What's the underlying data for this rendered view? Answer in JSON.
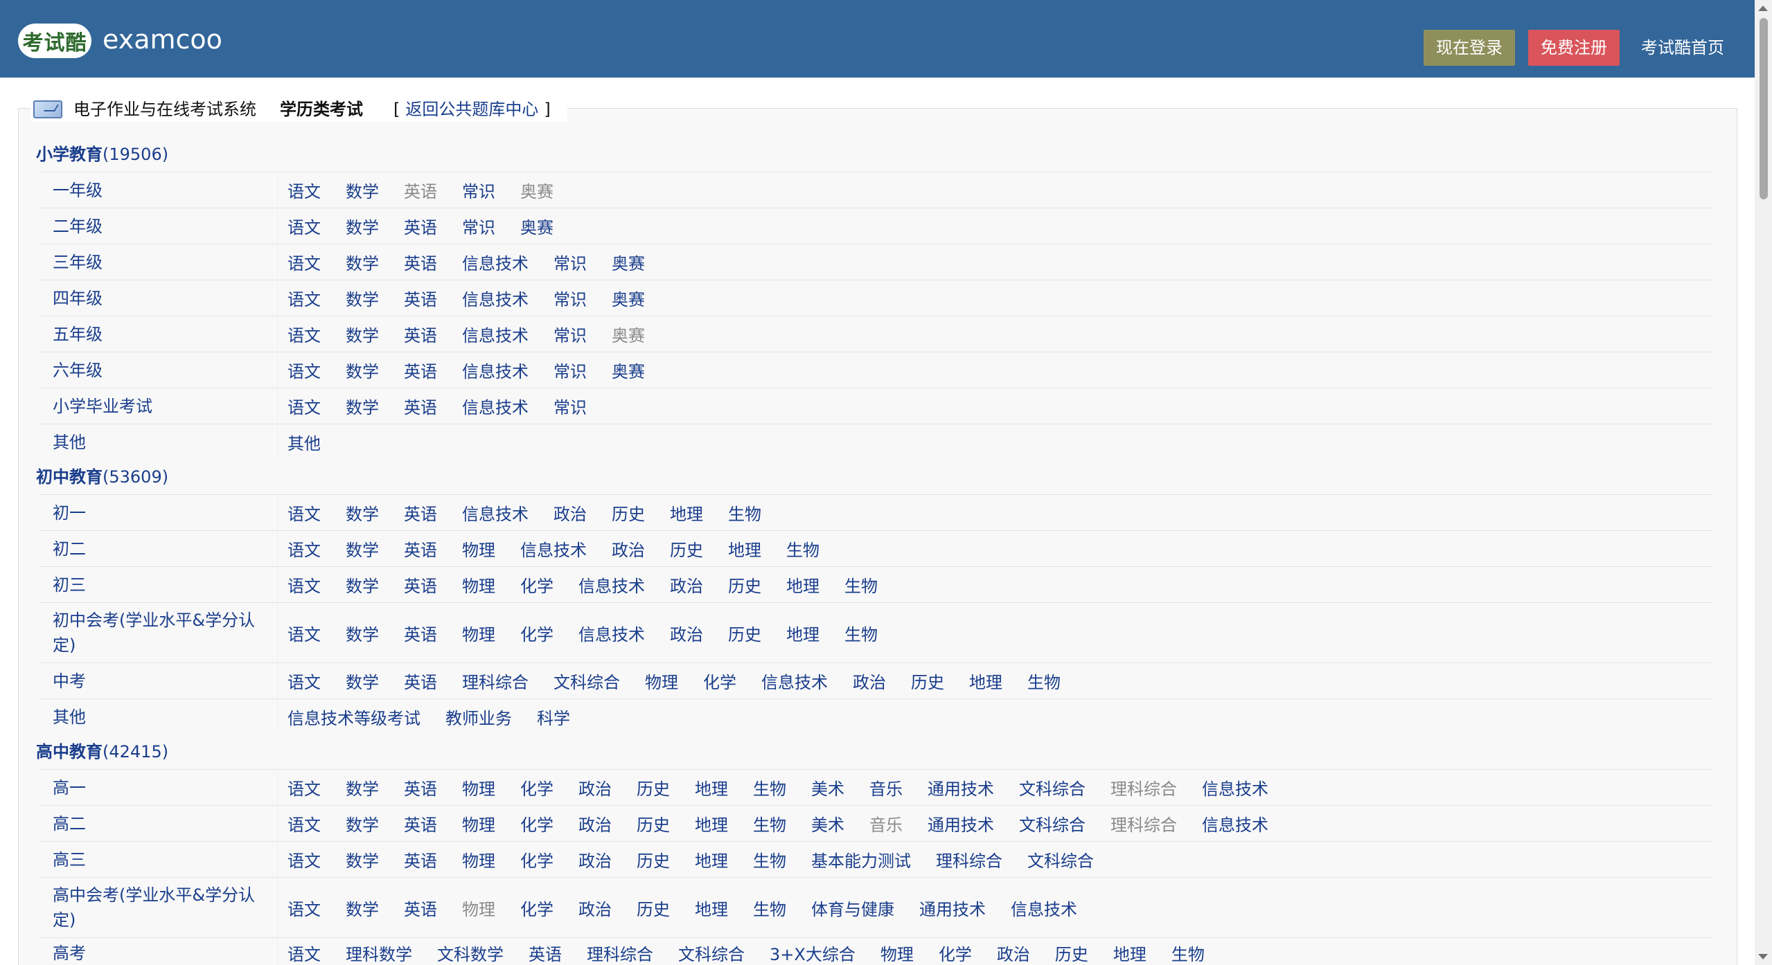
{
  "header": {
    "logo_badge_text": "考试酷",
    "logo_text": "examcoo",
    "login_label": "现在登录",
    "register_label": "免费注册",
    "home_label": "考试酷首页",
    "colors": {
      "bar": "#336699",
      "login": "#8f8f5c",
      "register": "#d9555b"
    }
  },
  "legend": {
    "system_label": "电子作业与在线考试系统",
    "active_label": "学历类考试",
    "bracket_open": "[",
    "back_link": "返回公共题库中心",
    "bracket_close": "]"
  },
  "categories": [
    {
      "name": "小学教育",
      "count": "(19506)",
      "rows": [
        {
          "label": "一年级",
          "subjects": [
            {
              "t": "语文"
            },
            {
              "t": "数学"
            },
            {
              "t": "英语",
              "muted": true
            },
            {
              "t": "常识"
            },
            {
              "t": "奥赛",
              "muted": true
            }
          ]
        },
        {
          "label": "二年级",
          "subjects": [
            {
              "t": "语文"
            },
            {
              "t": "数学"
            },
            {
              "t": "英语"
            },
            {
              "t": "常识"
            },
            {
              "t": "奥赛"
            }
          ]
        },
        {
          "label": "三年级",
          "subjects": [
            {
              "t": "语文"
            },
            {
              "t": "数学"
            },
            {
              "t": "英语"
            },
            {
              "t": "信息技术"
            },
            {
              "t": "常识"
            },
            {
              "t": "奥赛"
            }
          ]
        },
        {
          "label": "四年级",
          "subjects": [
            {
              "t": "语文"
            },
            {
              "t": "数学"
            },
            {
              "t": "英语"
            },
            {
              "t": "信息技术"
            },
            {
              "t": "常识"
            },
            {
              "t": "奥赛"
            }
          ]
        },
        {
          "label": "五年级",
          "subjects": [
            {
              "t": "语文"
            },
            {
              "t": "数学"
            },
            {
              "t": "英语"
            },
            {
              "t": "信息技术"
            },
            {
              "t": "常识"
            },
            {
              "t": "奥赛",
              "muted": true
            }
          ]
        },
        {
          "label": "六年级",
          "subjects": [
            {
              "t": "语文"
            },
            {
              "t": "数学"
            },
            {
              "t": "英语"
            },
            {
              "t": "信息技术"
            },
            {
              "t": "常识"
            },
            {
              "t": "奥赛"
            }
          ]
        },
        {
          "label": "小学毕业考试",
          "subjects": [
            {
              "t": "语文"
            },
            {
              "t": "数学"
            },
            {
              "t": "英语"
            },
            {
              "t": "信息技术"
            },
            {
              "t": "常识"
            }
          ]
        },
        {
          "label": "其他",
          "subjects": [
            {
              "t": "其他"
            }
          ]
        }
      ]
    },
    {
      "name": "初中教育",
      "count": "(53609)",
      "rows": [
        {
          "label": "初一",
          "subjects": [
            {
              "t": "语文"
            },
            {
              "t": "数学"
            },
            {
              "t": "英语"
            },
            {
              "t": "信息技术"
            },
            {
              "t": "政治"
            },
            {
              "t": "历史"
            },
            {
              "t": "地理"
            },
            {
              "t": "生物"
            }
          ]
        },
        {
          "label": "初二",
          "subjects": [
            {
              "t": "语文"
            },
            {
              "t": "数学"
            },
            {
              "t": "英语"
            },
            {
              "t": "物理"
            },
            {
              "t": "信息技术"
            },
            {
              "t": "政治"
            },
            {
              "t": "历史"
            },
            {
              "t": "地理"
            },
            {
              "t": "生物"
            }
          ]
        },
        {
          "label": "初三",
          "subjects": [
            {
              "t": "语文"
            },
            {
              "t": "数学"
            },
            {
              "t": "英语"
            },
            {
              "t": "物理"
            },
            {
              "t": "化学"
            },
            {
              "t": "信息技术"
            },
            {
              "t": "政治"
            },
            {
              "t": "历史"
            },
            {
              "t": "地理"
            },
            {
              "t": "生物"
            }
          ]
        },
        {
          "label": "初中会考(学业水平&学分认定)",
          "tall": true,
          "subjects": [
            {
              "t": "语文"
            },
            {
              "t": "数学"
            },
            {
              "t": "英语"
            },
            {
              "t": "物理"
            },
            {
              "t": "化学"
            },
            {
              "t": "信息技术"
            },
            {
              "t": "政治"
            },
            {
              "t": "历史"
            },
            {
              "t": "地理"
            },
            {
              "t": "生物"
            }
          ]
        },
        {
          "label": "中考",
          "subjects": [
            {
              "t": "语文"
            },
            {
              "t": "数学"
            },
            {
              "t": "英语"
            },
            {
              "t": "理科综合"
            },
            {
              "t": "文科综合"
            },
            {
              "t": "物理"
            },
            {
              "t": "化学"
            },
            {
              "t": "信息技术"
            },
            {
              "t": "政治"
            },
            {
              "t": "历史"
            },
            {
              "t": "地理"
            },
            {
              "t": "生物"
            }
          ]
        },
        {
          "label": "其他",
          "subjects": [
            {
              "t": "信息技术等级考试"
            },
            {
              "t": "教师业务"
            },
            {
              "t": "科学"
            }
          ]
        }
      ]
    },
    {
      "name": "高中教育",
      "count": "(42415)",
      "rows": [
        {
          "label": "高一",
          "subjects": [
            {
              "t": "语文"
            },
            {
              "t": "数学"
            },
            {
              "t": "英语"
            },
            {
              "t": "物理"
            },
            {
              "t": "化学"
            },
            {
              "t": "政治"
            },
            {
              "t": "历史"
            },
            {
              "t": "地理"
            },
            {
              "t": "生物"
            },
            {
              "t": "美术"
            },
            {
              "t": "音乐"
            },
            {
              "t": "通用技术"
            },
            {
              "t": "文科综合"
            },
            {
              "t": "理科综合",
              "muted": true
            },
            {
              "t": "信息技术"
            }
          ]
        },
        {
          "label": "高二",
          "subjects": [
            {
              "t": "语文"
            },
            {
              "t": "数学"
            },
            {
              "t": "英语"
            },
            {
              "t": "物理"
            },
            {
              "t": "化学"
            },
            {
              "t": "政治"
            },
            {
              "t": "历史"
            },
            {
              "t": "地理"
            },
            {
              "t": "生物"
            },
            {
              "t": "美术"
            },
            {
              "t": "音乐",
              "muted": true
            },
            {
              "t": "通用技术"
            },
            {
              "t": "文科综合"
            },
            {
              "t": "理科综合",
              "muted": true
            },
            {
              "t": "信息技术"
            }
          ]
        },
        {
          "label": "高三",
          "subjects": [
            {
              "t": "语文"
            },
            {
              "t": "数学"
            },
            {
              "t": "英语"
            },
            {
              "t": "物理"
            },
            {
              "t": "化学"
            },
            {
              "t": "政治"
            },
            {
              "t": "历史"
            },
            {
              "t": "地理"
            },
            {
              "t": "生物"
            },
            {
              "t": "基本能力测试"
            },
            {
              "t": "理科综合"
            },
            {
              "t": "文科综合"
            }
          ]
        },
        {
          "label": "高中会考(学业水平&学分认定)",
          "tall": true,
          "subjects": [
            {
              "t": "语文"
            },
            {
              "t": "数学"
            },
            {
              "t": "英语"
            },
            {
              "t": "物理",
              "muted": true
            },
            {
              "t": "化学"
            },
            {
              "t": "政治"
            },
            {
              "t": "历史"
            },
            {
              "t": "地理"
            },
            {
              "t": "生物"
            },
            {
              "t": "体育与健康"
            },
            {
              "t": "通用技术"
            },
            {
              "t": "信息技术"
            }
          ]
        },
        {
          "label": "高考",
          "clip": true,
          "subjects": [
            {
              "t": "语文"
            },
            {
              "t": "理科数学"
            },
            {
              "t": "文科数学"
            },
            {
              "t": "英语"
            },
            {
              "t": "理科综合"
            },
            {
              "t": "文科综合"
            },
            {
              "t": "3+X大综合"
            },
            {
              "t": "物理"
            },
            {
              "t": "化学"
            },
            {
              "t": "政治"
            },
            {
              "t": "历史"
            },
            {
              "t": "地理"
            },
            {
              "t": "生物"
            }
          ]
        }
      ]
    }
  ]
}
